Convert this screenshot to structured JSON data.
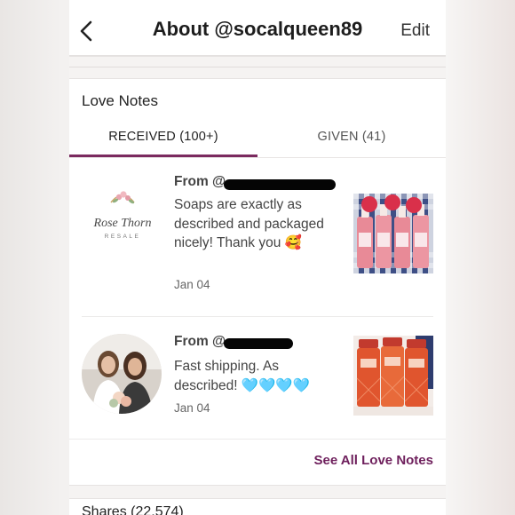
{
  "header": {
    "title": "About @socalqueen89",
    "edit_label": "Edit"
  },
  "love_notes": {
    "title": "Love Notes",
    "tabs": [
      {
        "label": "RECEIVED (100+)",
        "active": true
      },
      {
        "label": "GIVEN (41)",
        "active": false
      }
    ],
    "notes": [
      {
        "from_prefix": "From @",
        "comment": "Soaps are exactly as described and packaged nicely! Thank you 🥰",
        "date": "Jan 04",
        "avatar": "rose-thorn-resale-logo",
        "logo_text_1": "Rose Thorn",
        "logo_text_2": "RESALE"
      },
      {
        "from_prefix": "From @",
        "comment": "Fast shipping. As described! 🩵🩵🩵🩵",
        "date": "Jan 04",
        "avatar": "two-women-photo"
      }
    ],
    "see_all_label": "See All Love Notes"
  },
  "shares_label": "Shares (22,574)",
  "colors": {
    "accent": "#7b2a5f",
    "link": "#6e1f5c",
    "text": "#444444",
    "divider": "#e6e3e2"
  }
}
